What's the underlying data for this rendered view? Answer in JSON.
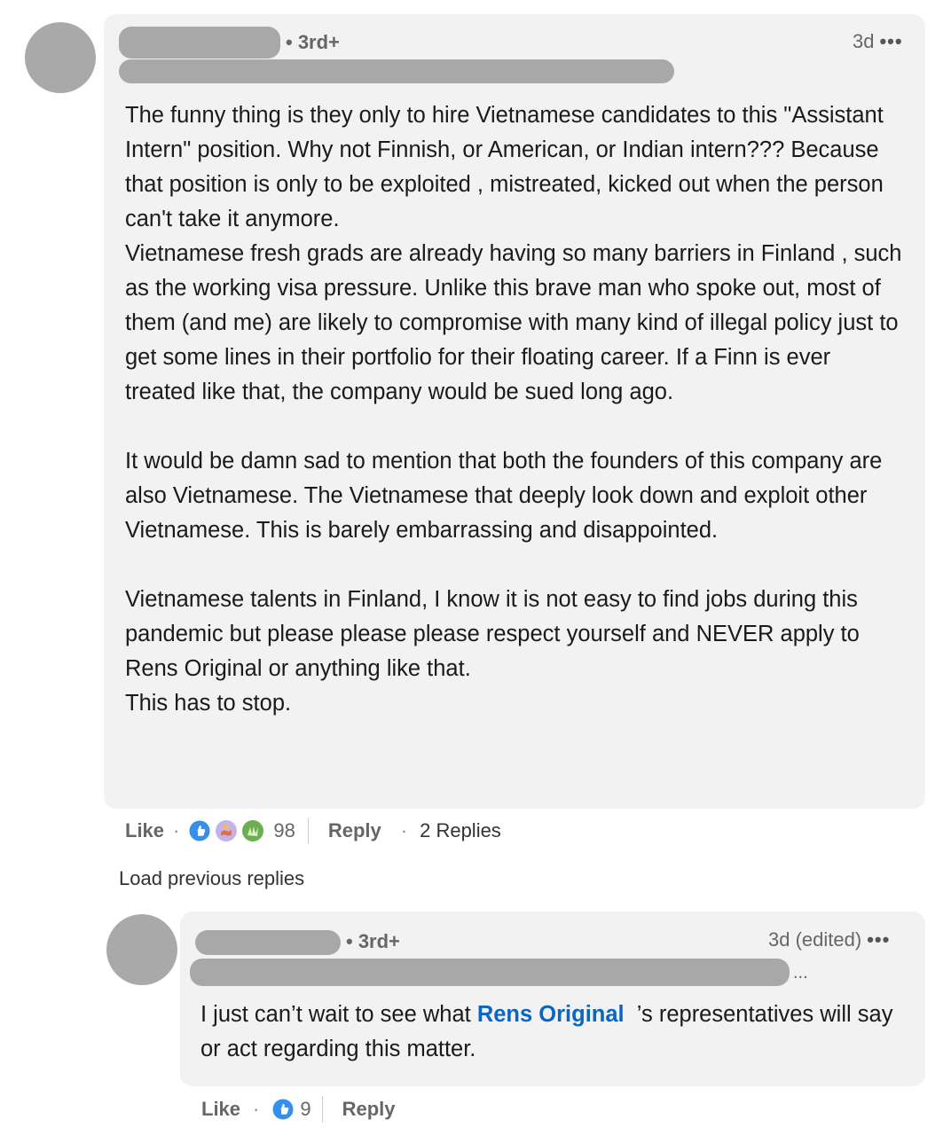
{
  "comment": {
    "degree": "• 3rd+",
    "timestamp": "3d",
    "more_icon": "•••",
    "paragraphs": [
      "The funny thing is they only to hire Vietnamese candidates to this \"Assistant Intern\" position. Why not Finnish, or American, or Indian intern??? Because that position is only to be exploited , mistreated, kicked out when the person can't take it anymore.",
      "Vietnamese fresh grads are already having so many barriers in Finland , such as the working visa pressure. Unlike this brave man who spoke out, most of them (and me) are likely to compromise with many kind of illegal policy just to get some lines in their portfolio for their floating career. If a Finn is ever treated like that, the company would be sued long ago.",
      "It would be damn sad to mention that both the founders of this company are also Vietnamese. The Vietnamese that deeply look down and exploit other Vietnamese. This is barely embarrassing and disappointed.",
      "Vietnamese talents in Finland, I know it is not easy to find jobs during this pandemic but please please please respect yourself and NEVER apply to Rens Original or anything like that.",
      "This has to stop."
    ],
    "actions": {
      "like": "Like",
      "reaction_count": "98",
      "reply": "Reply",
      "replies": "2 Replies"
    }
  },
  "load_previous": "Load previous replies",
  "reply": {
    "degree": "• 3rd+",
    "timestamp": "3d (edited)",
    "more_icon": "•••",
    "headline_tail": "...",
    "text_before": "I just can’t wait to see what ",
    "mention": "Rens Original",
    "text_after": "  ’s representatives will say or act regarding this matter.",
    "actions": {
      "like": "Like",
      "reaction_count": "9",
      "reply": "Reply"
    }
  },
  "colors": {
    "bubble": "#f2f2f2",
    "mention": "#0a66c2",
    "like_blue": "#378fe9",
    "avatar_placeholder": "#a9a9a9"
  }
}
